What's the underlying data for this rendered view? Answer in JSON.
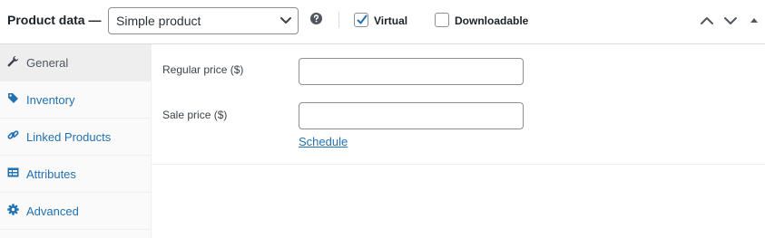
{
  "header": {
    "title": "Product data —",
    "product_type": {
      "selected": "Simple product",
      "icon": "chevron-down-icon"
    },
    "help_icon": "help-icon",
    "options": [
      {
        "label": "Virtual",
        "checked": true
      },
      {
        "label": "Downloadable",
        "checked": false
      }
    ],
    "controls": [
      "move-up-icon",
      "move-down-icon",
      "toggle-panel-icon"
    ]
  },
  "sidebar": {
    "tabs": [
      {
        "label": "General",
        "icon": "wrench-icon",
        "active": true
      },
      {
        "label": "Inventory",
        "icon": "tag-icon",
        "active": false
      },
      {
        "label": "Linked Products",
        "icon": "link-icon",
        "active": false
      },
      {
        "label": "Attributes",
        "icon": "table-icon",
        "active": false
      },
      {
        "label": "Advanced",
        "icon": "gear-icon",
        "active": false
      }
    ]
  },
  "general": {
    "regular_price": {
      "label": "Regular price ($)",
      "value": ""
    },
    "sale_price": {
      "label": "Sale price ($)",
      "value": ""
    },
    "schedule_link": "Schedule"
  },
  "colors": {
    "link": "#2271b1",
    "accent": "#2271b1",
    "border": "#8c8f94",
    "active_tab_bg": "#eeeeee"
  }
}
